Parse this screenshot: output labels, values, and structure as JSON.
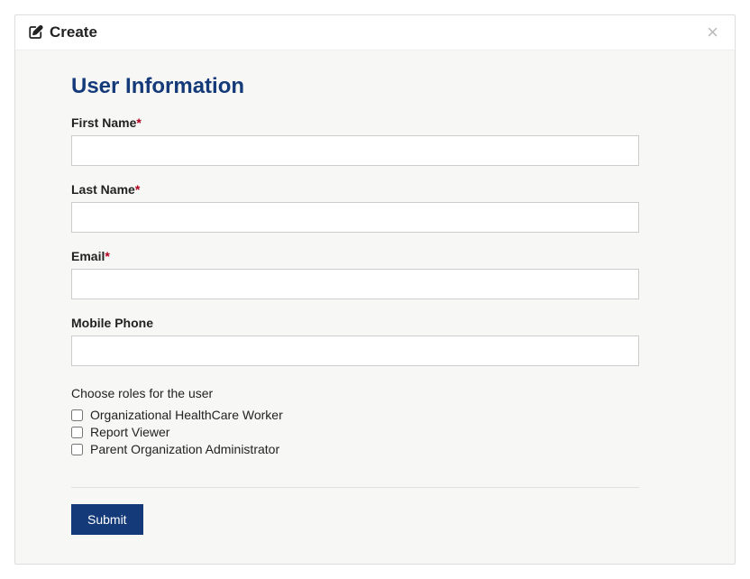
{
  "dialog": {
    "title": "Create"
  },
  "section": {
    "heading": "User Information"
  },
  "fields": {
    "first_name": {
      "label": "First Name",
      "required": true,
      "value": ""
    },
    "last_name": {
      "label": "Last Name",
      "required": true,
      "value": ""
    },
    "email": {
      "label": "Email",
      "required": true,
      "value": ""
    },
    "mobile": {
      "label": "Mobile Phone",
      "required": false,
      "value": ""
    }
  },
  "roles": {
    "title": "Choose roles for the user",
    "items": [
      {
        "label": "Organizational HealthCare Worker",
        "checked": false
      },
      {
        "label": "Report Viewer",
        "checked": false
      },
      {
        "label": "Parent Organization Administrator",
        "checked": false
      }
    ]
  },
  "actions": {
    "submit": "Submit"
  }
}
